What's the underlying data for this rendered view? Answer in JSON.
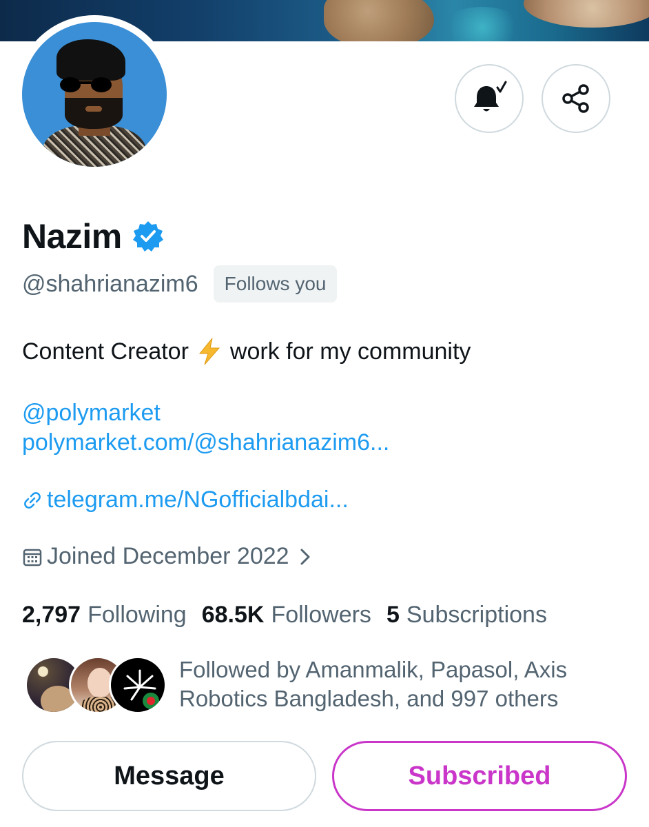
{
  "profile": {
    "name": "Nazim",
    "handle": "@shahrianazim6",
    "follows_badge": "Follows you",
    "bio_before": "Content Creator",
    "bio_after": "work for my community",
    "bio_emoji": "lightning-bolt-emoji",
    "mention": "@polymarket",
    "polymarket_url": "polymarket.com/@shahrianazim6...",
    "telegram_link": "telegram.me/NGofficialbdai...",
    "joined": "Joined December 2022"
  },
  "stats": {
    "following_count": "2,797",
    "following_label": "Following",
    "followers_count": "68.5K",
    "followers_label": "Followers",
    "subscriptions_count": "5",
    "subscriptions_label": "Subscriptions"
  },
  "followed_by": {
    "text": "Followed by Amanmalik, Papasol, Axis Robotics Bangladesh, and 997 others"
  },
  "actions": {
    "notify_icon": "bell-check-icon",
    "share_icon": "share-icon",
    "message_label": "Message",
    "subscribed_label": "Subscribed"
  },
  "colors": {
    "link": "#1d9bf0",
    "secondary_text": "#536471",
    "subscribed_accent": "#c936c9",
    "verified": "#1d9bf0"
  }
}
